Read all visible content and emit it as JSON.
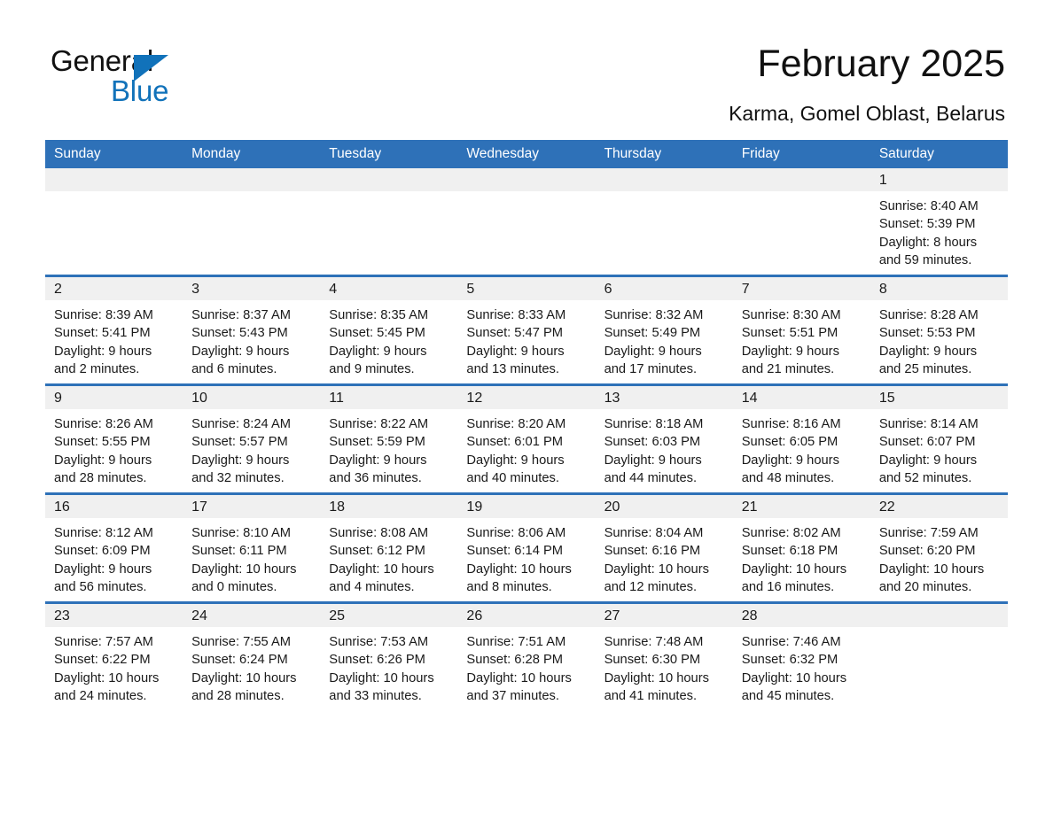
{
  "logo": {
    "word1": "General",
    "word2": "Blue",
    "triangle_color": "#1172ba"
  },
  "header": {
    "title": "February 2025",
    "subtitle": "Karma, Gomel Oblast, Belarus",
    "accent_color": "#2e71b8",
    "daynum_band_color": "#f0f0f0"
  },
  "calendar": {
    "weekday_headers": [
      "Sunday",
      "Monday",
      "Tuesday",
      "Wednesday",
      "Thursday",
      "Friday",
      "Saturday"
    ],
    "weeks": [
      [
        {
          "day": "",
          "empty": true
        },
        {
          "day": "",
          "empty": true
        },
        {
          "day": "",
          "empty": true
        },
        {
          "day": "",
          "empty": true
        },
        {
          "day": "",
          "empty": true
        },
        {
          "day": "",
          "empty": true
        },
        {
          "day": "1",
          "sunrise": "Sunrise: 8:40 AM",
          "sunset": "Sunset: 5:39 PM",
          "daylight": "Daylight: 8 hours and 59 minutes."
        }
      ],
      [
        {
          "day": "2",
          "sunrise": "Sunrise: 8:39 AM",
          "sunset": "Sunset: 5:41 PM",
          "daylight": "Daylight: 9 hours and 2 minutes."
        },
        {
          "day": "3",
          "sunrise": "Sunrise: 8:37 AM",
          "sunset": "Sunset: 5:43 PM",
          "daylight": "Daylight: 9 hours and 6 minutes."
        },
        {
          "day": "4",
          "sunrise": "Sunrise: 8:35 AM",
          "sunset": "Sunset: 5:45 PM",
          "daylight": "Daylight: 9 hours and 9 minutes."
        },
        {
          "day": "5",
          "sunrise": "Sunrise: 8:33 AM",
          "sunset": "Sunset: 5:47 PM",
          "daylight": "Daylight: 9 hours and 13 minutes."
        },
        {
          "day": "6",
          "sunrise": "Sunrise: 8:32 AM",
          "sunset": "Sunset: 5:49 PM",
          "daylight": "Daylight: 9 hours and 17 minutes."
        },
        {
          "day": "7",
          "sunrise": "Sunrise: 8:30 AM",
          "sunset": "Sunset: 5:51 PM",
          "daylight": "Daylight: 9 hours and 21 minutes."
        },
        {
          "day": "8",
          "sunrise": "Sunrise: 8:28 AM",
          "sunset": "Sunset: 5:53 PM",
          "daylight": "Daylight: 9 hours and 25 minutes."
        }
      ],
      [
        {
          "day": "9",
          "sunrise": "Sunrise: 8:26 AM",
          "sunset": "Sunset: 5:55 PM",
          "daylight": "Daylight: 9 hours and 28 minutes."
        },
        {
          "day": "10",
          "sunrise": "Sunrise: 8:24 AM",
          "sunset": "Sunset: 5:57 PM",
          "daylight": "Daylight: 9 hours and 32 minutes."
        },
        {
          "day": "11",
          "sunrise": "Sunrise: 8:22 AM",
          "sunset": "Sunset: 5:59 PM",
          "daylight": "Daylight: 9 hours and 36 minutes."
        },
        {
          "day": "12",
          "sunrise": "Sunrise: 8:20 AM",
          "sunset": "Sunset: 6:01 PM",
          "daylight": "Daylight: 9 hours and 40 minutes."
        },
        {
          "day": "13",
          "sunrise": "Sunrise: 8:18 AM",
          "sunset": "Sunset: 6:03 PM",
          "daylight": "Daylight: 9 hours and 44 minutes."
        },
        {
          "day": "14",
          "sunrise": "Sunrise: 8:16 AM",
          "sunset": "Sunset: 6:05 PM",
          "daylight": "Daylight: 9 hours and 48 minutes."
        },
        {
          "day": "15",
          "sunrise": "Sunrise: 8:14 AM",
          "sunset": "Sunset: 6:07 PM",
          "daylight": "Daylight: 9 hours and 52 minutes."
        }
      ],
      [
        {
          "day": "16",
          "sunrise": "Sunrise: 8:12 AM",
          "sunset": "Sunset: 6:09 PM",
          "daylight": "Daylight: 9 hours and 56 minutes."
        },
        {
          "day": "17",
          "sunrise": "Sunrise: 8:10 AM",
          "sunset": "Sunset: 6:11 PM",
          "daylight": "Daylight: 10 hours and 0 minutes."
        },
        {
          "day": "18",
          "sunrise": "Sunrise: 8:08 AM",
          "sunset": "Sunset: 6:12 PM",
          "daylight": "Daylight: 10 hours and 4 minutes."
        },
        {
          "day": "19",
          "sunrise": "Sunrise: 8:06 AM",
          "sunset": "Sunset: 6:14 PM",
          "daylight": "Daylight: 10 hours and 8 minutes."
        },
        {
          "day": "20",
          "sunrise": "Sunrise: 8:04 AM",
          "sunset": "Sunset: 6:16 PM",
          "daylight": "Daylight: 10 hours and 12 minutes."
        },
        {
          "day": "21",
          "sunrise": "Sunrise: 8:02 AM",
          "sunset": "Sunset: 6:18 PM",
          "daylight": "Daylight: 10 hours and 16 minutes."
        },
        {
          "day": "22",
          "sunrise": "Sunrise: 7:59 AM",
          "sunset": "Sunset: 6:20 PM",
          "daylight": "Daylight: 10 hours and 20 minutes."
        }
      ],
      [
        {
          "day": "23",
          "sunrise": "Sunrise: 7:57 AM",
          "sunset": "Sunset: 6:22 PM",
          "daylight": "Daylight: 10 hours and 24 minutes."
        },
        {
          "day": "24",
          "sunrise": "Sunrise: 7:55 AM",
          "sunset": "Sunset: 6:24 PM",
          "daylight": "Daylight: 10 hours and 28 minutes."
        },
        {
          "day": "25",
          "sunrise": "Sunrise: 7:53 AM",
          "sunset": "Sunset: 6:26 PM",
          "daylight": "Daylight: 10 hours and 33 minutes."
        },
        {
          "day": "26",
          "sunrise": "Sunrise: 7:51 AM",
          "sunset": "Sunset: 6:28 PM",
          "daylight": "Daylight: 10 hours and 37 minutes."
        },
        {
          "day": "27",
          "sunrise": "Sunrise: 7:48 AM",
          "sunset": "Sunset: 6:30 PM",
          "daylight": "Daylight: 10 hours and 41 minutes."
        },
        {
          "day": "28",
          "sunrise": "Sunrise: 7:46 AM",
          "sunset": "Sunset: 6:32 PM",
          "daylight": "Daylight: 10 hours and 45 minutes."
        },
        {
          "day": "",
          "empty": true
        }
      ]
    ]
  }
}
